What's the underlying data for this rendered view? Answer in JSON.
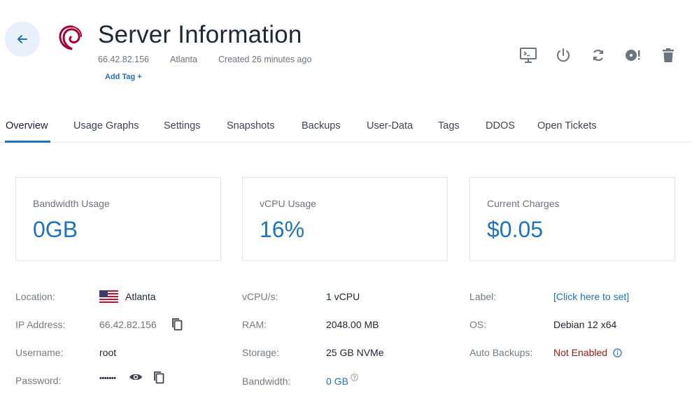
{
  "header": {
    "title": "Server Information",
    "ip": "66.42.82.156",
    "location": "Atlanta",
    "created": "Created 26 minutes ago",
    "add_tag": "Add Tag +"
  },
  "icons": {
    "back": "arrow-left-icon",
    "logo": "debian-logo",
    "actions": [
      "console-icon",
      "power-icon",
      "restart-icon",
      "iso-icon",
      "trash-icon"
    ]
  },
  "tabs": [
    {
      "label": "Overview",
      "active": true
    },
    {
      "label": "Usage Graphs"
    },
    {
      "label": "Settings"
    },
    {
      "label": "Snapshots"
    },
    {
      "label": "Backups"
    },
    {
      "label": "User-Data"
    },
    {
      "label": "Tags"
    },
    {
      "label": "DDOS"
    },
    {
      "label": "Open Tickets"
    }
  ],
  "cards": [
    {
      "label": "Bandwidth Usage",
      "value": "0GB"
    },
    {
      "label": "vCPU Usage",
      "value": "16%"
    },
    {
      "label": "Current Charges",
      "value": "$0.05"
    }
  ],
  "info": {
    "col1": [
      {
        "label": "Location:",
        "value": "Atlanta"
      },
      {
        "label": "IP Address:",
        "value": "66.42.82.156"
      },
      {
        "label": "Username:",
        "value": "root"
      },
      {
        "label": "Password:",
        "value": "•••••••"
      }
    ],
    "col2": [
      {
        "label": "vCPU/s:",
        "value": "1 vCPU"
      },
      {
        "label": "RAM:",
        "value": "2048.00 MB"
      },
      {
        "label": "Storage:",
        "value": "25 GB NVMe"
      },
      {
        "label": "Bandwidth:",
        "value": "0 GB"
      }
    ],
    "col3": [
      {
        "label": "Label:",
        "value": "[Click here to set]"
      },
      {
        "label": "OS:",
        "value": "Debian 12 x64"
      },
      {
        "label": "Auto Backups:",
        "value": "Not Enabled"
      }
    ]
  },
  "colors": {
    "accent": "#1e73be",
    "danger": "#a01818",
    "back_bg": "#e8f1fb",
    "debian": "#a80030"
  }
}
